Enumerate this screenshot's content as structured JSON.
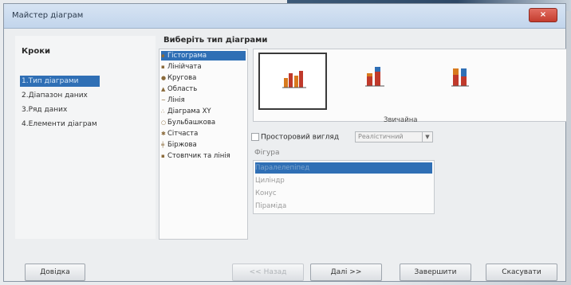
{
  "window": {
    "title": "Майстер діаграм",
    "close_label": "×"
  },
  "steps": {
    "heading": "Кроки",
    "items": [
      {
        "label": "1.Тип діаграми",
        "active": true
      },
      {
        "label": "2.Діапазон даних",
        "active": false
      },
      {
        "label": "3.Ряд даних",
        "active": false
      },
      {
        "label": "4.Елементи діаграм",
        "active": false
      }
    ]
  },
  "chart_type": {
    "heading": "Виберіть тип діаграми",
    "items": [
      {
        "label": "Гістограма",
        "icon": "bar-chart-icon",
        "selected": true
      },
      {
        "label": "Лінійчата",
        "icon": "horizontal-bar-icon",
        "selected": false
      },
      {
        "label": "Кругова",
        "icon": "pie-chart-icon",
        "selected": false
      },
      {
        "label": "Область",
        "icon": "area-chart-icon",
        "selected": false
      },
      {
        "label": "Лінія",
        "icon": "line-chart-icon",
        "selected": false
      },
      {
        "label": "Діаграма XY",
        "icon": "xy-chart-icon",
        "selected": false
      },
      {
        "label": "Бульбашкова",
        "icon": "bubble-chart-icon",
        "selected": false
      },
      {
        "label": "Сітчаста",
        "icon": "net-chart-icon",
        "selected": false
      },
      {
        "label": "Біржова",
        "icon": "stock-chart-icon",
        "selected": false
      },
      {
        "label": "Стовпчик та лінія",
        "icon": "column-line-icon",
        "selected": false
      }
    ]
  },
  "variants": {
    "selected_label": "Звичайна",
    "items": [
      "normal",
      "stacked",
      "percent-stacked"
    ]
  },
  "three_d": {
    "label": "Просторовий вигляд",
    "checked": false,
    "combo_value": "Реалістичний"
  },
  "shape": {
    "label": "Фігура",
    "items": [
      {
        "label": "Паралелепіпед",
        "selected": true
      },
      {
        "label": "Циліндр",
        "selected": false
      },
      {
        "label": "Конус",
        "selected": false
      },
      {
        "label": "Піраміда",
        "selected": false
      }
    ]
  },
  "buttons": {
    "help": "Довідка",
    "back": "<< Назад",
    "next": "Далі >>",
    "finish": "Завершити",
    "cancel": "Скасувати"
  },
  "colors": {
    "accent": "#2f6fb5",
    "bar_orange": "#d87a1e",
    "bar_red": "#c0392b"
  }
}
